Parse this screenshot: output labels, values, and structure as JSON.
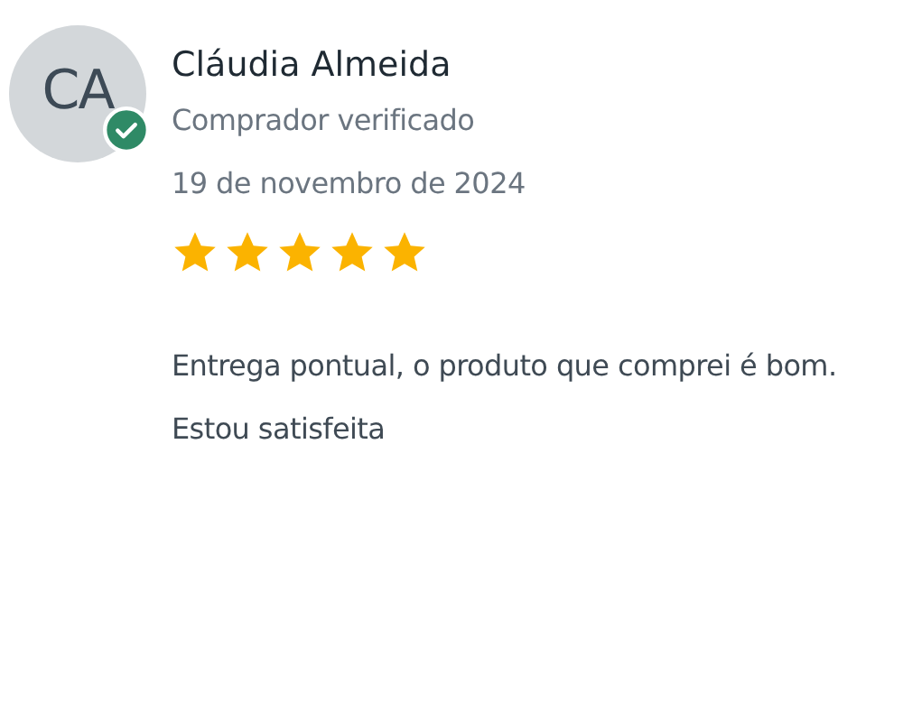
{
  "review": {
    "initials": "CA",
    "verified": true,
    "name": "Cláudia Almeida",
    "badge_text": "Comprador verificado",
    "date": "19 de novembro de 2024",
    "stars": 5,
    "text": "Entrega pontual, o produto que comprei é bom. Estou satisfeita"
  }
}
